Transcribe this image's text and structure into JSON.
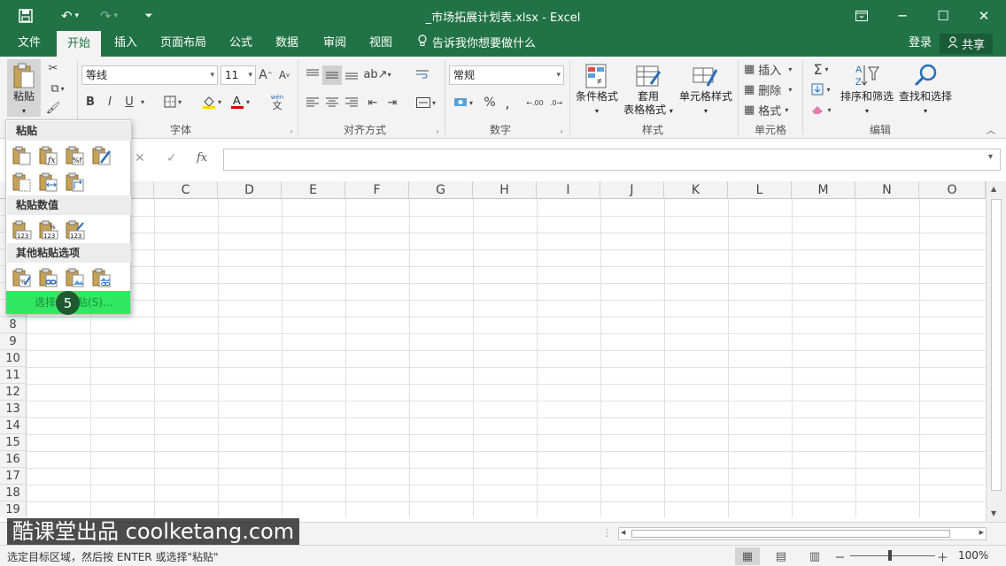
{
  "window": {
    "title": "_市场拓展计划表.xlsx  -  Excel"
  },
  "tabs": [
    "文件",
    "开始",
    "插入",
    "页面布局",
    "公式",
    "数据",
    "审阅",
    "视图"
  ],
  "tell_me": "告诉我你想要做什么",
  "account": {
    "login": "登录",
    "share": "共享"
  },
  "ribbon": {
    "paste_label": "粘贴",
    "font_name": "等线",
    "font_size": "11",
    "number_format": "常规",
    "groups": {
      "font": "字体",
      "alignment": "对齐方式",
      "number": "数字",
      "styles": "样式",
      "cells": "单元格",
      "editing": "编辑"
    },
    "styles_buttons": {
      "conditional": "条件格式",
      "table_format_1": "套用",
      "table_format_2": "表格格式",
      "cell_styles": "单元格样式"
    },
    "cells_buttons": {
      "insert": "插入",
      "delete": "删除",
      "format": "格式"
    },
    "editing_buttons": {
      "sort_filter": "排序和筛选",
      "find_select": "查找和选择"
    },
    "font_buttons": {
      "bold": "B",
      "italic": "I",
      "underline": "U",
      "wen": "wén",
      "wen_char": "文"
    },
    "number_buttons": {
      "percent": "%",
      "comma": ",",
      "inc": ".00",
      "dec": ".0"
    }
  },
  "formula_bar": {
    "fx": "fx"
  },
  "columns": [
    "C",
    "D",
    "E",
    "F",
    "G",
    "H",
    "I",
    "J",
    "K",
    "L",
    "M",
    "N",
    "O"
  ],
  "rows": [
    "8",
    "9",
    "10",
    "11",
    "12",
    "13",
    "14",
    "15",
    "16",
    "17",
    "18",
    "19"
  ],
  "paste_menu": {
    "section_paste": "粘贴",
    "section_values": "粘贴数值",
    "section_other": "其他粘贴选项",
    "special": "选择性粘贴(S)...",
    "step_badge": "5"
  },
  "status": {
    "message": "选定目标区域，然后按 ENTER 或选择\"粘贴\"",
    "zoom": "100%",
    "zoom_minus": "－",
    "zoom_plus": "＋"
  },
  "watermark": "酷课堂出品 coolketang.com",
  "colors": {
    "excel_green": "#217346",
    "menu_highlight": "#32e862",
    "badge": "#1d5a30"
  }
}
